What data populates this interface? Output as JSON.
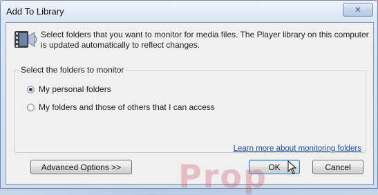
{
  "window": {
    "title": "Add To Library",
    "close_icon": "x-close-icon"
  },
  "intro": {
    "icon": "media-library-icon",
    "text": "Select folders that you want to monitor for media files. The Player library on this computer is updated automatically to reflect changes."
  },
  "group": {
    "legend": "Select the folders to monitor",
    "options": [
      {
        "label": "My personal folders",
        "selected": true
      },
      {
        "label": "My folders and those of others that I can access",
        "selected": false
      }
    ],
    "learn_more_link": "Learn more about monitoring folders"
  },
  "buttons": {
    "advanced": "Advanced Options >>",
    "ok": "OK",
    "cancel": "Cancel"
  },
  "background": {
    "watermark_text": "Prop"
  }
}
